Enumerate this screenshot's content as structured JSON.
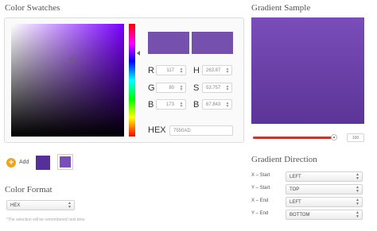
{
  "colorSwatches": {
    "title": "Color Swatches",
    "rgb": {
      "r_label": "R",
      "r": "117",
      "g_label": "G",
      "g": "80",
      "b_label": "B",
      "b": "173"
    },
    "hsb": {
      "h_label": "H",
      "h": "263.87",
      "s_label": "S",
      "s": "53.757",
      "b_label": "B",
      "b": "67.843"
    },
    "hex_label": "HEX",
    "hex": "7550AD",
    "add_label": "Add",
    "colors": {
      "base_hue": "#7a00ff",
      "previous": "#7550ad",
      "current": "#7550ad",
      "saved1": "#55309a",
      "saved2": "#7a4db8"
    }
  },
  "colorFormat": {
    "title": "Color Format",
    "selected": "HEX",
    "note": "*The selection will be remembered next time."
  },
  "gradientSample": {
    "title": "Gradient Sample",
    "slider_value": "100",
    "colors": {
      "top": "#7a4db8",
      "bottom": "#5c3598",
      "slider": "#c0392b"
    }
  },
  "gradientDirection": {
    "title": "Gradient Direction",
    "rows": [
      {
        "label": "X – Start",
        "value": "LEFT"
      },
      {
        "label": "Y – Start",
        "value": "TOP"
      },
      {
        "label": "X – End",
        "value": "LEFT"
      },
      {
        "label": "Y – End",
        "value": "BOTTOM"
      }
    ]
  },
  "icons": {
    "add": "plus-icon",
    "spinner": "up-down-arrows-icon",
    "select": "up-down-arrows-icon"
  }
}
